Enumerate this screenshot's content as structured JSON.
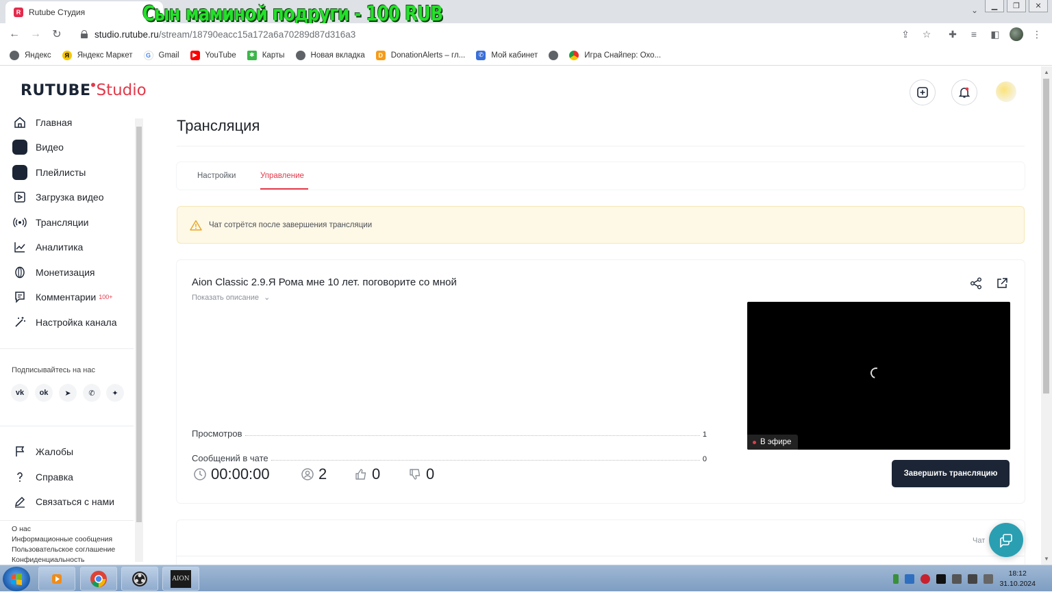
{
  "browser": {
    "tab_title": "Rutube Студия",
    "overlay_caption": "Сын маминой подруги - 100 RUB",
    "url_host": "studio.rutube.ru",
    "url_path": "/stream/18790eacc15a172a6a70289d87d316a3",
    "bookmarks": [
      "Яндекс",
      "Яндекс Маркет",
      "Gmail",
      "YouTube",
      "Карты",
      "Новая вкладка",
      "DonationAlerts – гл...",
      "Мой кабинет",
      "",
      "Игра Снайпер: Охо..."
    ]
  },
  "header": {
    "logo_main": "RUTUBE",
    "logo_studio": "Studio"
  },
  "sidebar": {
    "items": [
      {
        "label": "Главная"
      },
      {
        "label": "Видео"
      },
      {
        "label": "Плейлисты"
      },
      {
        "label": "Загрузка видео"
      },
      {
        "label": "Трансляции"
      },
      {
        "label": "Аналитика"
      },
      {
        "label": "Монетизация"
      },
      {
        "label": "Комментарии",
        "badge": "100+"
      },
      {
        "label": "Настройка канала"
      }
    ],
    "subscribe_heading": "Подписывайтесь на нас",
    "socials": [
      "vk-icon",
      "ok-icon",
      "telegram-icon",
      "viber-icon",
      "plus-icon"
    ],
    "bottom_items": [
      {
        "label": "Жалобы"
      },
      {
        "label": "Справка"
      },
      {
        "label": "Связаться с нами"
      }
    ],
    "footer_links": [
      "О нас",
      "Информационные сообщения",
      "Пользовательское соглашение",
      "Конфиденциальность"
    ]
  },
  "main": {
    "page_title": "Трансляция",
    "tabs": [
      {
        "label": "Настройки",
        "active": false
      },
      {
        "label": "Управление",
        "active": true
      }
    ],
    "warning_text": "Чат сотрётся после завершения трансляции",
    "stream": {
      "title": "Aion Classic 2.9.Я Рома мне 10 лет. поговорите со мной",
      "show_description": "Показать описание",
      "stats": [
        {
          "label": "Просмотров",
          "value": "1"
        },
        {
          "label": "Сообщений в чате",
          "value": "0"
        }
      ],
      "live_label": "В эфире",
      "duration": "00:00:00",
      "viewers": "2",
      "likes": "0",
      "dislikes": "0",
      "end_button": "Завершить трансляцию"
    },
    "chat_label": "Чат"
  },
  "taskbar": {
    "time": "18:12",
    "date": "31.10.2024"
  },
  "colors": {
    "accent": "#e3394a",
    "dark": "#1b2535",
    "warning_bg": "#fef8e7"
  }
}
